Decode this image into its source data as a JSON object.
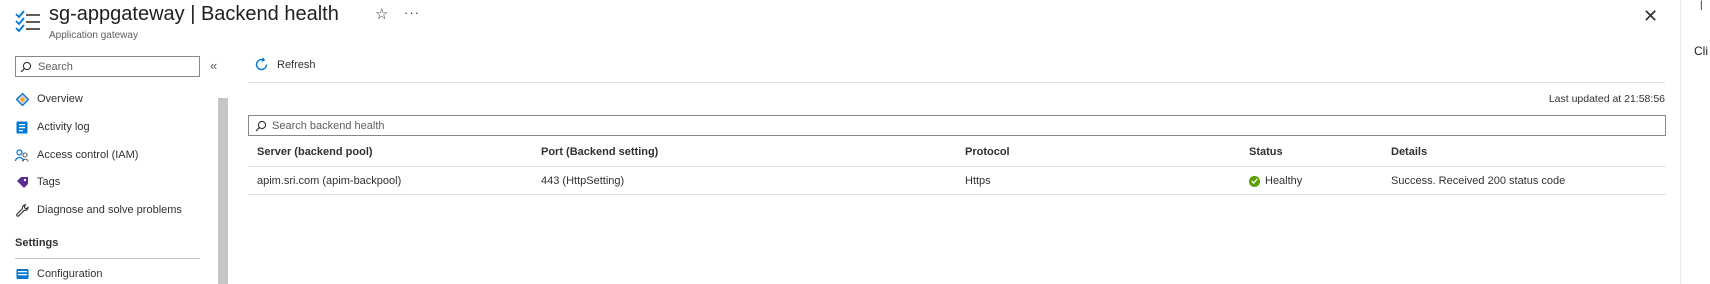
{
  "header": {
    "title": "sg-appgateway | Backend health",
    "subtitle": "Application gateway",
    "more_label": "···"
  },
  "edge": {
    "partial_text": "Cli"
  },
  "nav": {
    "search_placeholder": "Search",
    "collapse_label": "«",
    "items": [
      {
        "label": "Overview",
        "icon": "overview-icon"
      },
      {
        "label": "Activity log",
        "icon": "activity-log-icon"
      },
      {
        "label": "Access control (IAM)",
        "icon": "iam-icon"
      },
      {
        "label": "Tags",
        "icon": "tag-icon"
      },
      {
        "label": "Diagnose and solve problems",
        "icon": "wrench-icon"
      }
    ],
    "section_settings": "Settings",
    "settings_items": [
      {
        "label": "Configuration",
        "icon": "configuration-icon"
      }
    ]
  },
  "toolbar": {
    "refresh_label": "Refresh"
  },
  "main": {
    "last_updated": "Last updated at 21:58:56",
    "search_placeholder": "Search backend health",
    "columns": [
      "Server (backend pool)",
      "Port (Backend setting)",
      "Protocol",
      "Status",
      "Details"
    ],
    "rows": [
      {
        "server": "apim.sri.com (apim-backpool)",
        "port": "443 (HttpSetting)",
        "protocol": "Https",
        "status": "Healthy",
        "details": "Success. Received 200 status code"
      }
    ]
  },
  "colors": {
    "accent": "#0078d4",
    "healthy": "#57a300"
  }
}
